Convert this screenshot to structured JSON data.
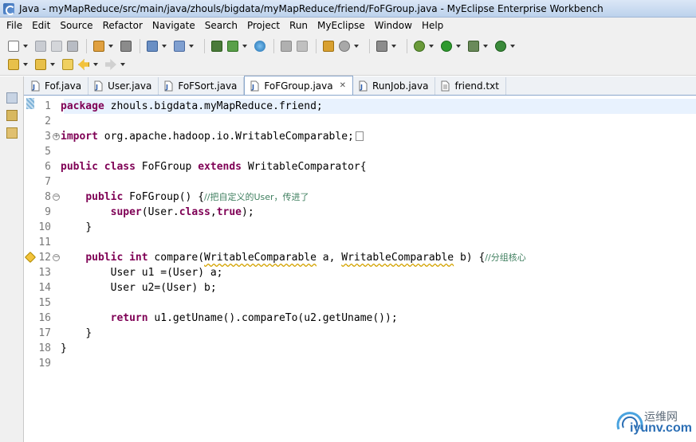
{
  "window": {
    "title": "Java - myMapReduce/src/main/java/zhouls/bigdata/myMapReduce/friend/FoFGroup.java - MyEclipse Enterprise Workbench"
  },
  "menu": [
    "File",
    "Edit",
    "Source",
    "Refactor",
    "Navigate",
    "Search",
    "Project",
    "Run",
    "MyEclipse",
    "Window",
    "Help"
  ],
  "tabs": [
    {
      "label": "Fof.java",
      "icon": "java-file-icon",
      "active": false
    },
    {
      "label": "User.java",
      "icon": "java-file-icon",
      "active": false
    },
    {
      "label": "FoFSort.java",
      "icon": "java-file-icon",
      "active": false
    },
    {
      "label": "FoFGroup.java",
      "icon": "java-file-icon",
      "active": true
    },
    {
      "label": "RunJob.java",
      "icon": "java-file-icon",
      "active": false
    },
    {
      "label": "friend.txt",
      "icon": "text-file-icon",
      "active": false
    }
  ],
  "editor": {
    "line_numbers": [
      "1",
      "2",
      "3",
      "5",
      "6",
      "7",
      "8",
      "9",
      "10",
      "11",
      "12",
      "13",
      "14",
      "15",
      "16",
      "17",
      "18",
      "19"
    ],
    "lines": [
      {
        "n": "1",
        "parts": [
          [
            "kw",
            "package"
          ],
          [
            "",
            "zhouls.bigdata.myMapReduce.friend;"
          ]
        ]
      },
      {
        "n": "2",
        "parts": []
      },
      {
        "n": "3",
        "parts": [
          [
            "kw",
            "import"
          ],
          [
            "",
            "org.apache.hadoop.io.WritableComparable;"
          ]
        ],
        "collapsed": true
      },
      {
        "n": "5",
        "parts": []
      },
      {
        "n": "6",
        "parts": [
          [
            "kw",
            "public"
          ],
          [
            "kw",
            "class"
          ],
          [
            "",
            "FoFGroup"
          ],
          [
            "kw",
            "extends"
          ],
          [
            "",
            "WritableComparator{"
          ]
        ]
      },
      {
        "n": "7",
        "parts": []
      },
      {
        "n": "8",
        "parts": [
          [
            "kw",
            "public"
          ],
          [
            "",
            "FoFGroup() {"
          ],
          [
            "cm",
            "//把自定义的User，传进了"
          ]
        ]
      },
      {
        "n": "9",
        "parts": [
          [
            "kw",
            "super"
          ],
          [
            "",
            "(User."
          ],
          [
            "kw",
            "class"
          ],
          [
            "",
            ","
          ],
          [
            "kw",
            "true"
          ],
          [
            "",
            ");"
          ]
        ]
      },
      {
        "n": "10",
        "parts": [
          [
            "",
            "}"
          ]
        ]
      },
      {
        "n": "11",
        "parts": []
      },
      {
        "n": "12",
        "parts": [
          [
            "kw",
            "public"
          ],
          [
            "kw",
            "int"
          ],
          [
            "",
            "compare("
          ],
          [
            "warn",
            "WritableComparable"
          ],
          [
            "",
            "a, "
          ],
          [
            "warn",
            "WritableComparable"
          ],
          [
            "",
            "b) {"
          ],
          [
            "cm",
            "//分组核心"
          ]
        ]
      },
      {
        "n": "13",
        "parts": [
          [
            "",
            "User u1 =(User) a;"
          ]
        ]
      },
      {
        "n": "14",
        "parts": [
          [
            "",
            "User u2=(User) b;"
          ]
        ]
      },
      {
        "n": "15",
        "parts": []
      },
      {
        "n": "16",
        "parts": [
          [
            "kw",
            "return"
          ],
          [
            "",
            "u1.getUname().compareTo(u2.getUname());"
          ]
        ]
      },
      {
        "n": "17",
        "parts": [
          [
            "",
            "}"
          ]
        ]
      },
      {
        "n": "18",
        "parts": [
          [
            "",
            "}"
          ]
        ]
      },
      {
        "n": "19",
        "parts": []
      }
    ]
  },
  "watermark": {
    "cn": "运维网",
    "en": "iyunv.com"
  },
  "colors": {
    "keyword": "#7f0055",
    "comment": "#3f7f5f",
    "current_line": "#e8f2fe"
  }
}
